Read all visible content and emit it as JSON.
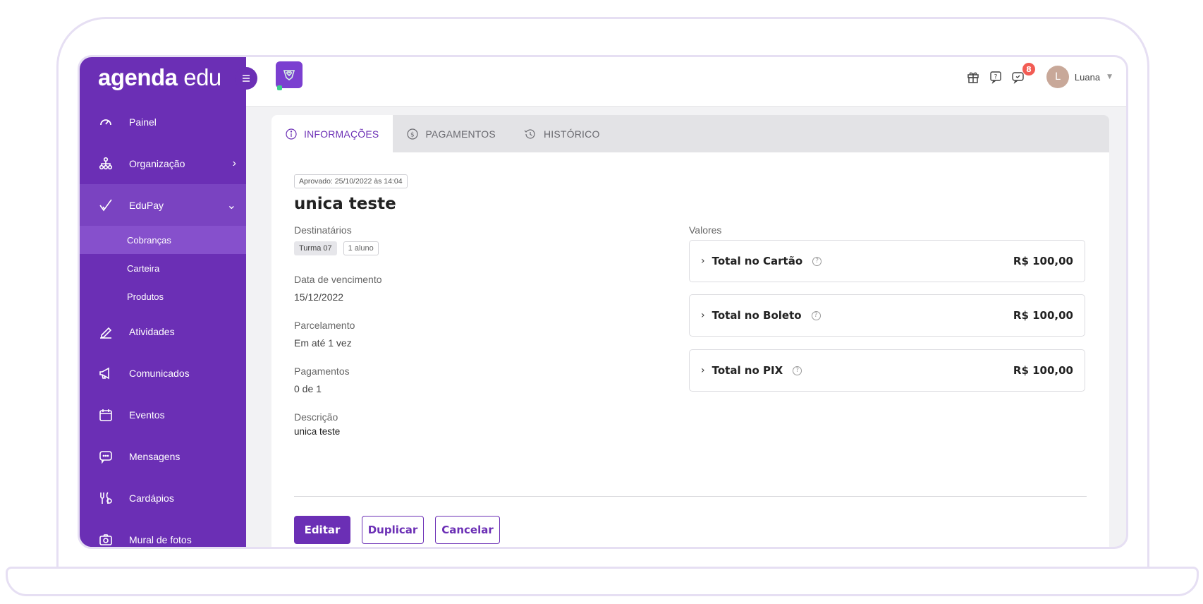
{
  "brand": {
    "bold": "agenda",
    "light": " edu"
  },
  "sidebar": {
    "items": [
      {
        "label": "Painel",
        "icon": "speedometer-icon"
      },
      {
        "label": "Organização",
        "icon": "org-chart-icon"
      },
      {
        "label": "EduPay",
        "icon": "checkmark-icon"
      },
      {
        "label": "Atividades",
        "icon": "pencil-icon"
      },
      {
        "label": "Comunicados",
        "icon": "megaphone-icon"
      },
      {
        "label": "Eventos",
        "icon": "calendar-icon"
      },
      {
        "label": "Mensagens",
        "icon": "chat-icon"
      },
      {
        "label": "Cardápios",
        "icon": "utensils-icon"
      },
      {
        "label": "Mural de fotos",
        "icon": "camera-icon"
      }
    ],
    "submenu": [
      "Cobranças",
      "Carteira",
      "Produtos"
    ]
  },
  "topbar": {
    "notification_count": "8",
    "avatar_initial": "L",
    "username": "Luana"
  },
  "tabs": [
    "INFORMAÇÕES",
    "PAGAMENTOS",
    "HISTÓRICO"
  ],
  "detail": {
    "approved": "Aprovado: 25/10/2022 às 14:04",
    "title": "unica teste",
    "destinatarios_label": "Destinatários",
    "tags": [
      "Turma 07",
      "1 aluno"
    ],
    "vencimento_label": "Data de vencimento",
    "vencimento_value": "15/12/2022",
    "parcelamento_label": "Parcelamento",
    "parcelamento_value": "Em até 1 vez",
    "pagamentos_label": "Pagamentos",
    "pagamentos_value": "0 de 1",
    "descricao_label": "Descrição",
    "descricao_value": "unica teste"
  },
  "valores": {
    "label": "Valores",
    "totals": [
      {
        "label": "Total no Cartão",
        "amount": "R$ 100,00"
      },
      {
        "label": "Total no Boleto",
        "amount": "R$ 100,00"
      },
      {
        "label": "Total no PIX",
        "amount": "R$ 100,00"
      }
    ]
  },
  "actions": {
    "edit": "Editar",
    "duplicate": "Duplicar",
    "cancel": "Cancelar"
  },
  "colors": {
    "primary": "#6b2fb5",
    "notification": "#f25c54"
  }
}
